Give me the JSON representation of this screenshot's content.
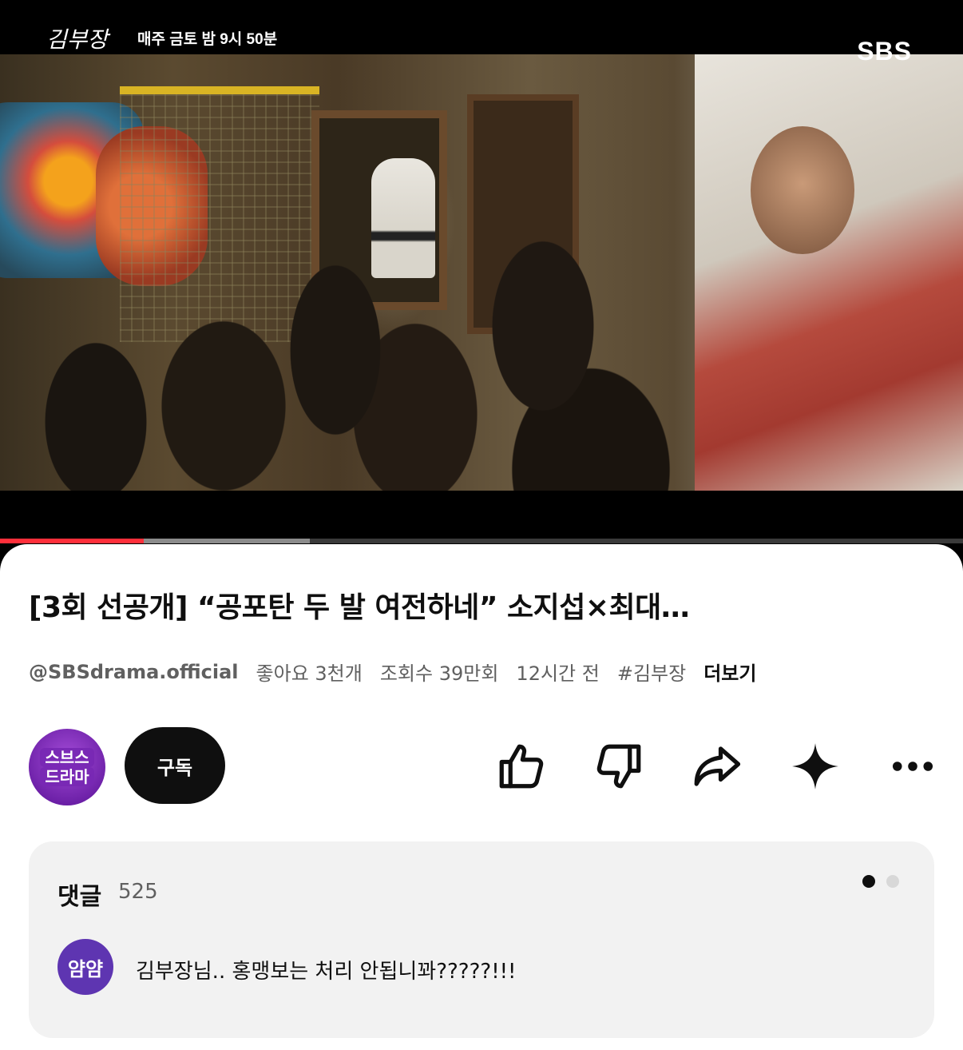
{
  "video": {
    "show_logo": "김부장",
    "schedule": "매주 금토 밤 9시 50분",
    "broadcaster": "SBS",
    "progress_played_fraction": 0.149,
    "progress_buffered_fraction": 0.322
  },
  "details": {
    "title": "[3회 선공개] “공포탄 두 발 여전하네” 소지섭×최대…",
    "channel_handle": "@SBSdrama.official",
    "likes": "좋아요 3천개",
    "views": "조회수 39만회",
    "age": "12시간 전",
    "hashtag": "#김부장",
    "more_label": "더보기"
  },
  "channel": {
    "avatar_line1": "스브스",
    "avatar_line2": "드라마",
    "subscribe_label": "구독"
  },
  "actions": [
    {
      "name": "like",
      "icon": "thumbs-up-icon"
    },
    {
      "name": "dislike",
      "icon": "thumbs-down-icon"
    },
    {
      "name": "share",
      "icon": "share-arrow-icon"
    },
    {
      "name": "ask",
      "icon": "sparkle-icon"
    },
    {
      "name": "more",
      "icon": "more-horizontal-icon"
    }
  ],
  "comments": {
    "label": "댓글",
    "count": "525",
    "top_comment": {
      "avatar_text": "얌얌",
      "text": "김부장님.. 홍맹보는 처리 안됩니꽈?????!!!"
    }
  },
  "colors": {
    "progress_played": "#ff2f3b",
    "subscribe_bg": "#0f0f0f",
    "comment_avatar": "#5e35b1",
    "channel_avatar": "#8a2fc6"
  }
}
